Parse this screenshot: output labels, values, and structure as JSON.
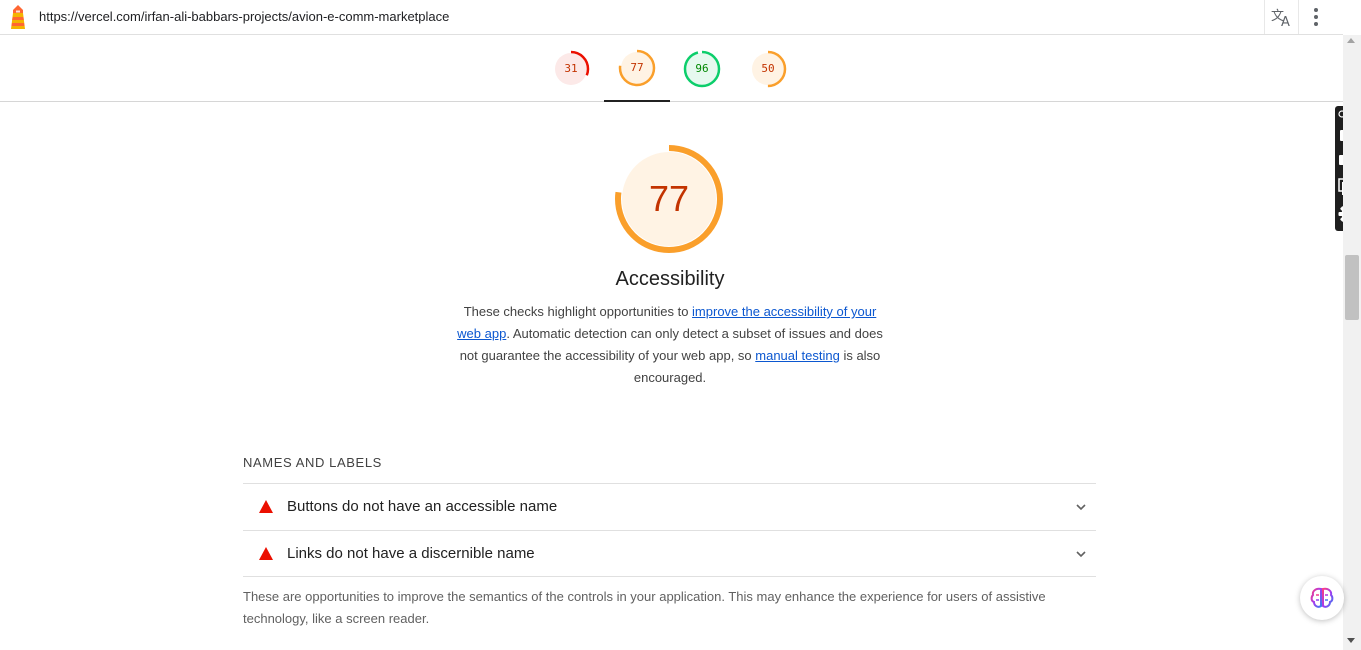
{
  "url": "https://vercel.com/irfan-ali-babbars-projects/avion-e-comm-marketplace",
  "tabs": [
    {
      "score": "31",
      "color": "#eb0f00",
      "fill": "#fce9e8",
      "value": 0.31
    },
    {
      "score": "77",
      "color": "#fa9f2b",
      "fill": "#fff3e4",
      "value": 0.77
    },
    {
      "score": "96",
      "color": "#0cce6b",
      "fill": "#e6f9ef",
      "value": 0.96
    },
    {
      "score": "50",
      "color": "#fa9f2b",
      "fill": "#fff3e4",
      "value": 0.5
    }
  ],
  "active_tab_index": 1,
  "category": {
    "score": "77",
    "value": 0.77,
    "title": "Accessibility",
    "desc_part1": "These checks highlight opportunities to ",
    "desc_link1": "improve the accessibility of your web app",
    "desc_part2": ". Automatic detection can only detect a subset of issues and does not guarantee the accessibility of your web app, so ",
    "desc_link2": "manual testing",
    "desc_part3": " is also encouraged."
  },
  "group": {
    "title": "NAMES AND LABELS",
    "audits": [
      {
        "title": "Buttons do not have an accessible name"
      },
      {
        "title": "Links do not have a discernible name"
      }
    ],
    "description": "These are opportunities to improve the semantics of the controls in your application. This may enhance the experience for users of assistive technology, like a screen reader."
  },
  "icons": {
    "logo": "lighthouse-icon",
    "translate": "translate-icon",
    "menu": "kebab-menu-icon",
    "audit_fail": "red-triangle-icon",
    "expand": "chevron-down-icon",
    "toolbar": [
      "camera-icon",
      "video-icon",
      "window-stack-icon",
      "gear-icon"
    ],
    "assistant": "brain-icon"
  }
}
